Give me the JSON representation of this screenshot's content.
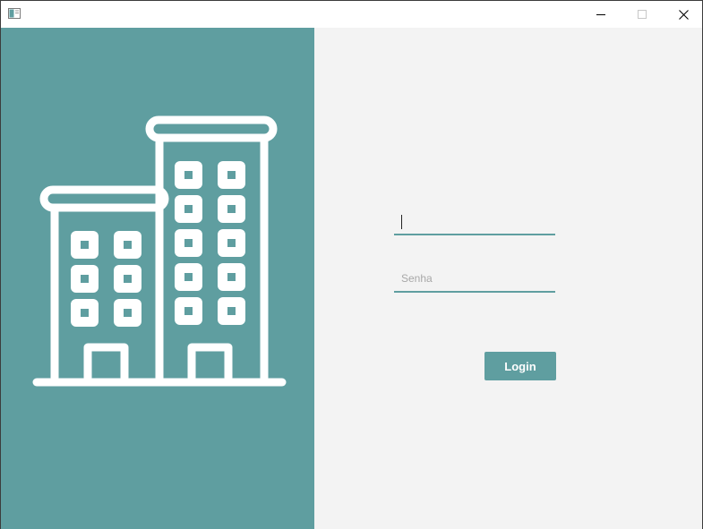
{
  "window": {
    "app_icon": "window-app-icon",
    "controls": {
      "minimize_icon": "minimize-icon",
      "maximize_icon": "maximize-icon",
      "close_icon": "close-icon"
    }
  },
  "left_panel": {
    "background_color": "#5f9ea0",
    "illustration": "building-icon"
  },
  "login_form": {
    "username": {
      "value": "",
      "placeholder": ""
    },
    "password": {
      "value": "",
      "placeholder": "Senha"
    },
    "submit_label": "Login"
  },
  "colors": {
    "accent": "#5f9ea0",
    "form_background": "#f3f3f3"
  }
}
